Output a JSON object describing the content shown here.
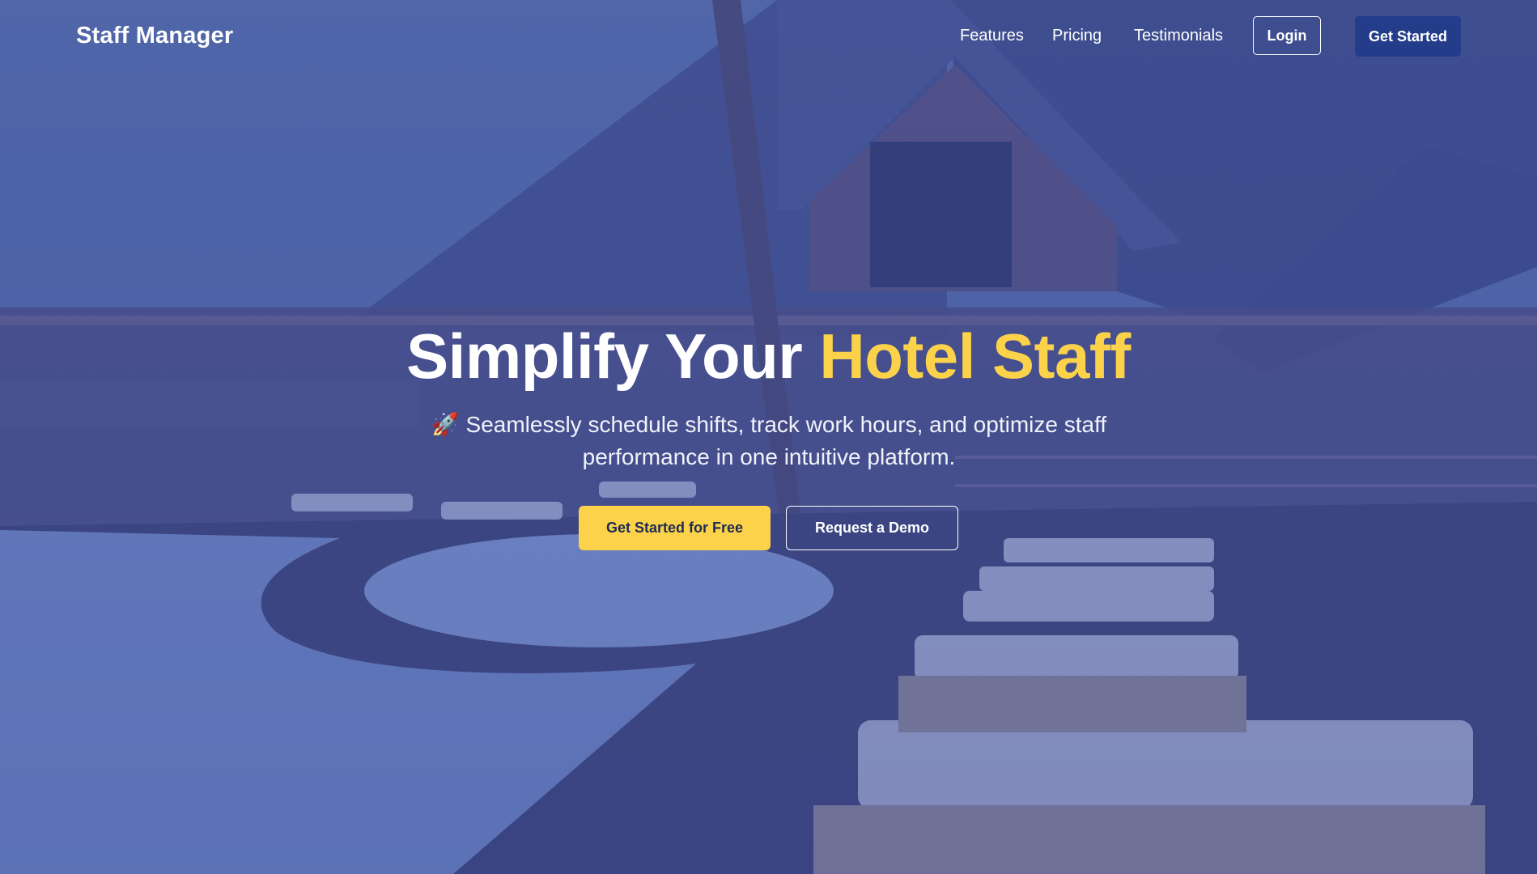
{
  "brand": {
    "name": "Staff Manager"
  },
  "nav": {
    "links": [
      {
        "label": "Features"
      },
      {
        "label": "Pricing"
      },
      {
        "label": "Testimonials"
      }
    ],
    "login_label": "Login",
    "get_started_label": "Get Started"
  },
  "hero": {
    "headline_main": "Simplify Your ",
    "headline_accent": "Hotel Staff",
    "subtext_icon": "rocket-icon",
    "subtext": "🚀 Seamlessly schedule shifts, track work hours, and optimize staff performance in one intuitive platform.",
    "primary_cta": "Get Started for Free",
    "secondary_cta": "Request a Demo"
  },
  "colors": {
    "accent_yellow": "#fcd24a",
    "nav_button_blue": "#233d8a",
    "overlay_blue": "#3f5499"
  }
}
